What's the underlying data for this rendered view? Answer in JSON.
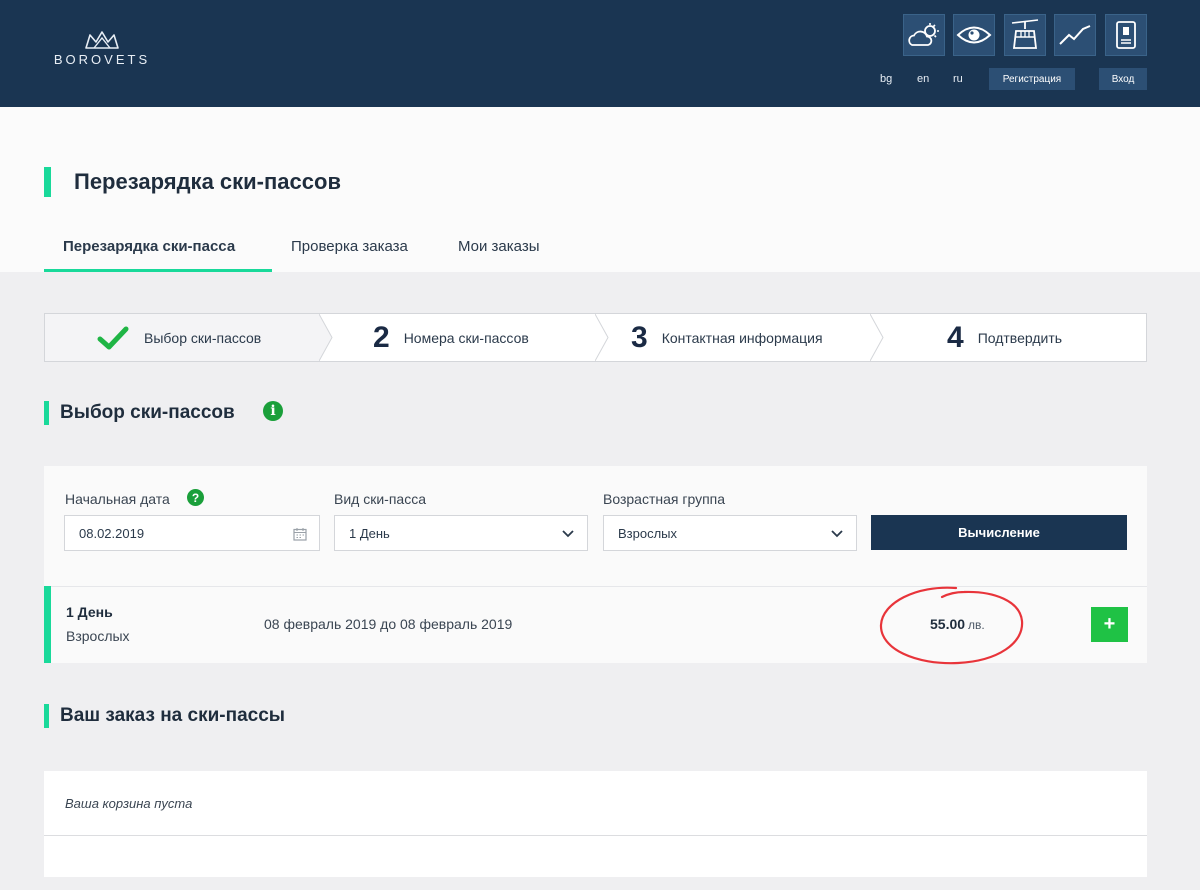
{
  "header": {
    "brand": "BOROVETS",
    "icons": [
      "weather-icon",
      "webcam-eye-icon",
      "gondola-lift-icon",
      "chart-trend-icon",
      "ski-pass-card-icon"
    ],
    "languages": [
      "bg",
      "en",
      "ru"
    ],
    "register_label": "Регистрация",
    "login_label": "Вход"
  },
  "page": {
    "title": "Перезарядка ски-пассов",
    "tabs": [
      {
        "label": "Перезарядка ски-пасса",
        "active": true
      },
      {
        "label": "Проверка заказа",
        "active": false
      },
      {
        "label": "Мои заказы",
        "active": false
      }
    ]
  },
  "steps": [
    {
      "number": "",
      "label": "Выбор ски-пассов",
      "done": true
    },
    {
      "number": "2",
      "label": "Номера ски-пассов",
      "done": false
    },
    {
      "number": "3",
      "label": "Контактная информация",
      "done": false
    },
    {
      "number": "4",
      "label": "Подтвердить",
      "done": false
    }
  ],
  "selection": {
    "title": "Выбор ски-пассов",
    "start_date_label": "Начальная дата",
    "start_date_value": "08.02.2019",
    "pass_type_label": "Вид ски-пасса",
    "pass_type_value": "1 День",
    "age_group_label": "Возрастная группа",
    "age_group_value": "Взрослых",
    "calculate_label": "Вычисление"
  },
  "result": {
    "name": "1 День",
    "group": "Взрослых",
    "range": "08 февраль 2019 до 08 февраль 2019",
    "price": "55.00",
    "currency": "лв.",
    "add_label": "+"
  },
  "cart": {
    "title": "Ваш заказ на ски-пассы",
    "empty_text": "Ваша корзина пуста"
  },
  "colors": {
    "header_bg": "#1a3552",
    "accent": "#19d99a",
    "add_button": "#1fc245",
    "annotation": "#e8343a"
  }
}
